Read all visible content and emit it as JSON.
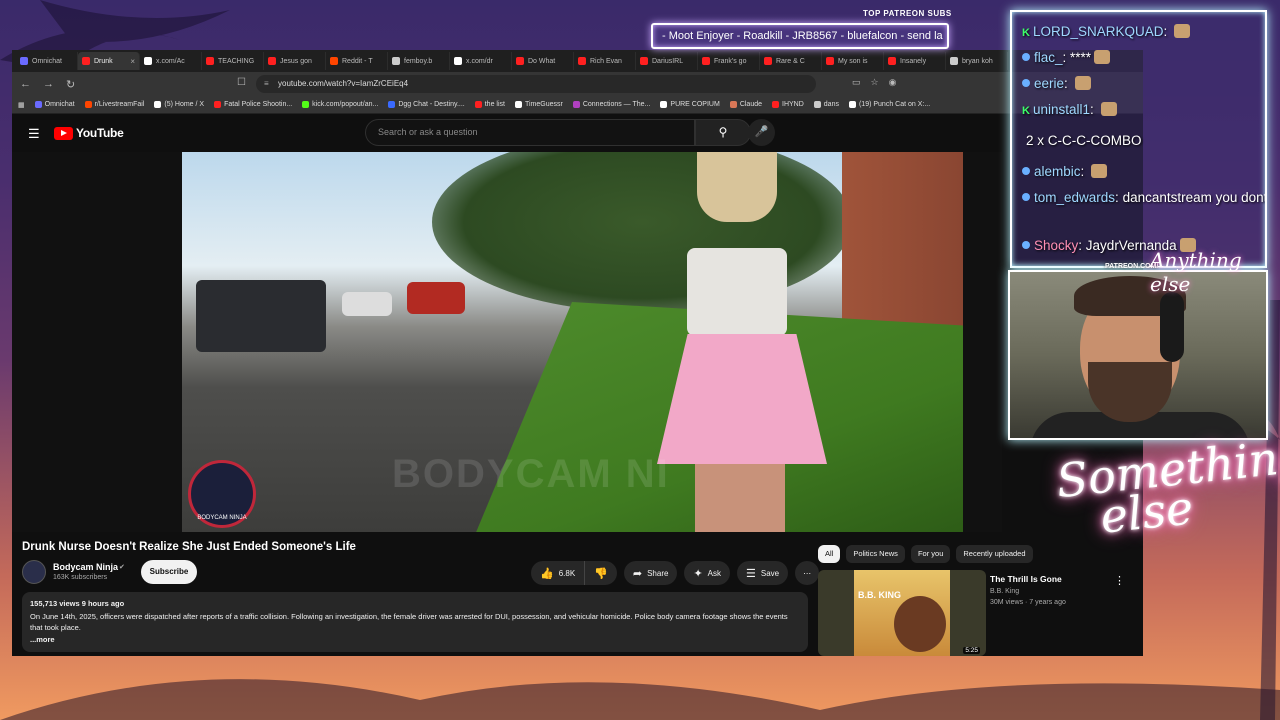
{
  "browser": {
    "tabs": [
      {
        "label": "Omnichat",
        "color": "#6a6aff"
      },
      {
        "label": "Drunk",
        "color": "#ff2020",
        "active": true
      },
      {
        "label": "x.com/Ac",
        "color": "#ffffff"
      },
      {
        "label": "TEACHING",
        "color": "#ff2020"
      },
      {
        "label": "Jesus gon",
        "color": "#ff2020"
      },
      {
        "label": "Reddit - T",
        "color": "#ff4500"
      },
      {
        "label": "femboy.b",
        "color": "#cccccc"
      },
      {
        "label": "x.com/dr",
        "color": "#ffffff"
      },
      {
        "label": "Do What",
        "color": "#ff2020"
      },
      {
        "label": "Rich Evan",
        "color": "#ff2020"
      },
      {
        "label": "DariusIRL",
        "color": "#ff2020"
      },
      {
        "label": "Frank's go",
        "color": "#ff2020"
      },
      {
        "label": "Rare & C",
        "color": "#ff2020"
      },
      {
        "label": "My son is",
        "color": "#ff2020"
      },
      {
        "label": "Insanely",
        "color": "#ff2020"
      },
      {
        "label": "bryan koh",
        "color": "#cccccc"
      }
    ],
    "url": "youtube.com/watch?v=IamZrCEiEq4",
    "bookmarks": [
      {
        "label": "Omnichat",
        "color": "#6a6aff"
      },
      {
        "label": "r/LivestreamFail",
        "color": "#ff4500"
      },
      {
        "label": "(5) Home / X",
        "color": "#ffffff"
      },
      {
        "label": "Fatal Police Shootin...",
        "color": "#ff2020"
      },
      {
        "label": "kick.com/popout/an...",
        "color": "#53fc18"
      },
      {
        "label": "Dgg Chat - Destiny....",
        "color": "#3a6aff"
      },
      {
        "label": "the list",
        "color": "#ff2020"
      },
      {
        "label": "TimeGuessr",
        "color": "#ffffff"
      },
      {
        "label": "Connections — The...",
        "color": "#b040c0"
      },
      {
        "label": "PURE COPIUM",
        "color": "#ffffff"
      },
      {
        "label": "Claude",
        "color": "#d97757"
      },
      {
        "label": "IHYND",
        "color": "#ff2020"
      },
      {
        "label": "dans",
        "color": "#cccccc"
      },
      {
        "label": "(19) Punch Cat on X:...",
        "color": "#ffffff"
      }
    ]
  },
  "youtube": {
    "logo_text": "YouTube",
    "search_placeholder": "Search or ask a question",
    "video_watermark": "BODYCAM NI",
    "video_badge": "BODYCAM NINJA",
    "title": "Drunk Nurse Doesn't Realize She Just Ended Someone's Life",
    "channel_name": "Bodycam Ninja",
    "channel_subs": "163K subscribers",
    "subscribe_label": "Subscribe",
    "likes": "6.8K",
    "share_label": "Share",
    "ask_label": "Ask",
    "save_label": "Save",
    "description_meta": "155,713 views  9 hours ago",
    "description_text": "On June 14th, 2025, officers were dispatched after reports of a traffic collision.  Following an investigation, the female driver was arrested for DUI, possession, and vehicular homicide.  Police body camera footage shows the events that took place.",
    "description_more": "...more",
    "chips": [
      "All",
      "Politics News",
      "For you",
      "Recently uploaded"
    ],
    "recommendation": {
      "title": "The Thrill Is Gone",
      "channel": "B.B. King",
      "meta": "30M views · 7 years ago",
      "thumb_text": "B.B. KING",
      "duration": "5:25"
    }
  },
  "overlay": {
    "patreon_label": "TOP PATREON SUBS",
    "patreon_ticker": "- Moot Enjoyer - Roadkill - JRB8567 - bluefalcon - send la",
    "chat": [
      {
        "user": "LORD_SNARKQUAD",
        "text": "",
        "badge": "kick"
      },
      {
        "user": "flac_",
        "text": "****"
      },
      {
        "user": "eerie",
        "text": ""
      },
      {
        "user": "uninstall1",
        "text": "",
        "badge": "kick"
      },
      {
        "user": "alembic",
        "text": ""
      },
      {
        "user": "tom_edwards",
        "text": "dancantstream you dont control me"
      },
      {
        "user": "Shocky",
        "text": "JaydrVernanda",
        "pink": true
      }
    ],
    "combo": "2 x C-C-C-COMBO",
    "patreon_url": "PATREON.COM/",
    "cam_script": "Anything else",
    "neon_line1": "Something",
    "neon_line2": "else"
  }
}
